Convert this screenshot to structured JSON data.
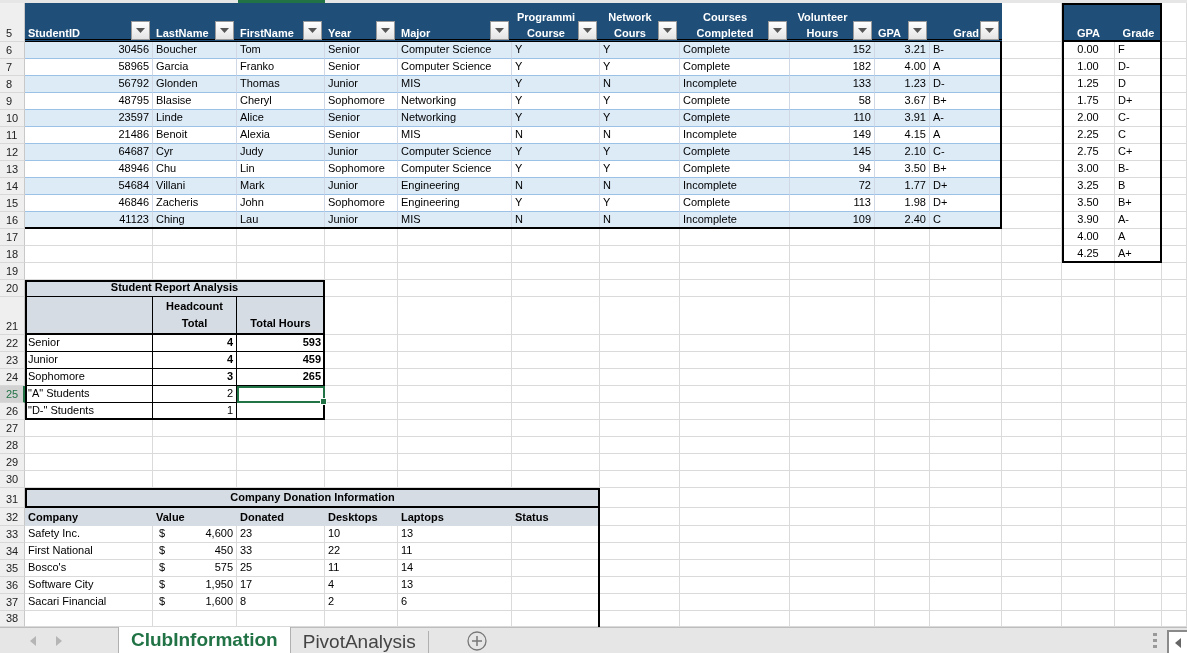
{
  "row_numbers": [
    "5",
    "6",
    "7",
    "8",
    "9",
    "10",
    "11",
    "12",
    "13",
    "14",
    "15",
    "16",
    "17",
    "18",
    "19",
    "20",
    "21",
    "22",
    "23",
    "24",
    "25",
    "26",
    "27",
    "28",
    "29",
    "30",
    "31",
    "32",
    "33",
    "34",
    "35",
    "36",
    "37",
    "38"
  ],
  "student_table": {
    "columns": [
      "StudentID",
      "LastName",
      "FirstName",
      "Year",
      "Major",
      "Programmi\nCourse",
      "Network\nCours",
      "Courses\nCompleted",
      "Volunteer\nHours",
      "GPA",
      "Grad"
    ],
    "rows": [
      [
        "30456",
        "Boucher",
        "Tom",
        "Senior",
        "Computer Science",
        "Y",
        "Y",
        "Complete",
        "152",
        "3.21",
        "B-"
      ],
      [
        "58965",
        "Garcia",
        "Franko",
        "Senior",
        "Computer Science",
        "Y",
        "Y",
        "Complete",
        "182",
        "4.00",
        "A"
      ],
      [
        "56792",
        "Glonden",
        "Thomas",
        "Junior",
        "MIS",
        "Y",
        "N",
        "Incomplete",
        "133",
        "1.23",
        "D-"
      ],
      [
        "48795",
        "Blasise",
        "Cheryl",
        "Sophomore",
        "Networking",
        "Y",
        "Y",
        "Complete",
        "58",
        "3.67",
        "B+"
      ],
      [
        "23597",
        "Linde",
        "Alice",
        "Senior",
        "Networking",
        "Y",
        "Y",
        "Complete",
        "110",
        "3.91",
        "A-"
      ],
      [
        "21486",
        "Benoit",
        "Alexia",
        "Senior",
        "MIS",
        "N",
        "N",
        "Incomplete",
        "149",
        "4.15",
        "A"
      ],
      [
        "64687",
        "Cyr",
        "Judy",
        "Junior",
        "Computer Science",
        "Y",
        "Y",
        "Complete",
        "145",
        "2.10",
        "C-"
      ],
      [
        "48946",
        "Chu",
        "Lin",
        "Sophomore",
        "Computer Science",
        "Y",
        "Y",
        "Complete",
        "94",
        "3.50",
        "B+"
      ],
      [
        "54684",
        "Villani",
        "Mark",
        "Junior",
        "Engineering",
        "N",
        "N",
        "Incomplete",
        "72",
        "1.77",
        "D+"
      ],
      [
        "46846",
        "Zacheris",
        "John",
        "Sophomore",
        "Engineering",
        "Y",
        "Y",
        "Complete",
        "113",
        "1.98",
        "D+"
      ],
      [
        "41123",
        "Ching",
        "Lau",
        "Junior",
        "MIS",
        "N",
        "N",
        "Incomplete",
        "109",
        "2.40",
        "C"
      ]
    ]
  },
  "grade_scale": {
    "columns": [
      "GPA",
      "Grade"
    ],
    "rows": [
      [
        "0.00",
        "F"
      ],
      [
        "1.00",
        "D-"
      ],
      [
        "1.25",
        "D"
      ],
      [
        "1.75",
        "D+"
      ],
      [
        "2.00",
        "C-"
      ],
      [
        "2.25",
        "C"
      ],
      [
        "2.75",
        "C+"
      ],
      [
        "3.00",
        "B-"
      ],
      [
        "3.25",
        "B"
      ],
      [
        "3.50",
        "B+"
      ],
      [
        "3.90",
        "A-"
      ],
      [
        "4.00",
        "A"
      ],
      [
        "4.25",
        "A+"
      ]
    ]
  },
  "student_report": {
    "title": "Student Report Analysis",
    "columns": [
      "Headcount\nTotal",
      "Total Hours"
    ],
    "rows": [
      {
        "label": "Senior",
        "headcount": "4",
        "total_hours": "593",
        "bold": true,
        "selected": false
      },
      {
        "label": "Junior",
        "headcount": "4",
        "total_hours": "459",
        "bold": true,
        "selected": false
      },
      {
        "label": "Sophomore",
        "headcount": "3",
        "total_hours": "265",
        "bold": true,
        "selected": false
      },
      {
        "label": "\"A\" Students",
        "headcount": "2",
        "bold": false,
        "selected": true
      },
      {
        "label": "\"D-\" Students",
        "headcount": "1",
        "bold": false,
        "selected": false
      }
    ]
  },
  "donations": {
    "title": "Company Donation Information",
    "columns": [
      "Company",
      "Value",
      "Donated",
      "Desktops",
      "Laptops",
      "Status"
    ],
    "rows": [
      {
        "company": "Safety Inc.",
        "currency": "$",
        "value": "4,600",
        "donated": "23",
        "desktops": "10",
        "laptops": "13"
      },
      {
        "company": "First National",
        "currency": "$",
        "value": "450",
        "donated": "33",
        "desktops": "22",
        "laptops": "11"
      },
      {
        "company": "Bosco's",
        "currency": "$",
        "value": "575",
        "donated": "25",
        "desktops": "11",
        "laptops": "14"
      },
      {
        "company": "Software City",
        "currency": "$",
        "value": "1,950",
        "donated": "17",
        "desktops": "4",
        "laptops": "13"
      },
      {
        "company": "Sacari Financial",
        "currency": "$",
        "value": "1,600",
        "donated": "8",
        "desktops": "2",
        "laptops": "6"
      }
    ]
  },
  "sheet_tabs": [
    {
      "label": "ClubInformation",
      "selected": true
    },
    {
      "label": "PivotAnalysis",
      "selected": false
    }
  ]
}
